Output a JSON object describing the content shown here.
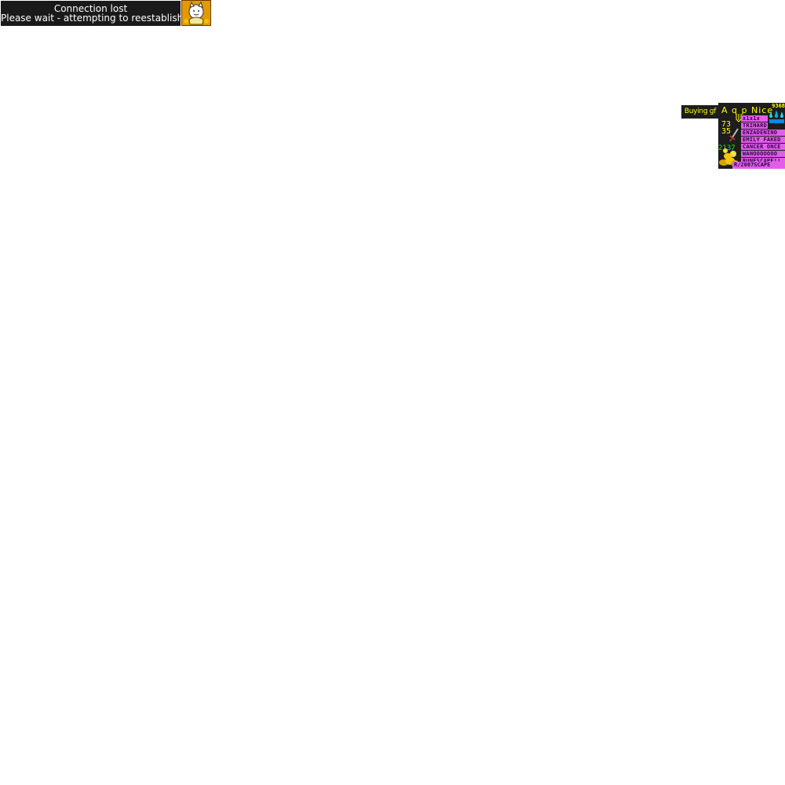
{
  "connection": {
    "title": "Connection lost",
    "message": "Please wait - attempting to reestablish"
  },
  "overlay": {
    "tag": "Buying gf",
    "title": "A q p Nice",
    "counter": "9368",
    "stat_1": "73",
    "stat_2": "35",
    "stat_3": "2137",
    "names": [
      "x1x1x",
      "TRIHARD",
      "ENZADENINO",
      "EMILY FAKED",
      "CANCER ONCE",
      "WAHOOOOOOO",
      "RUNESCAPE!!"
    ],
    "footer": "R/2007SCAPE"
  },
  "colors": {
    "panel_bg": "#1d1d1d",
    "text_yellow": "#ffff00",
    "name_pink": "#e15eea",
    "avatar_orange": "#e39a00"
  }
}
